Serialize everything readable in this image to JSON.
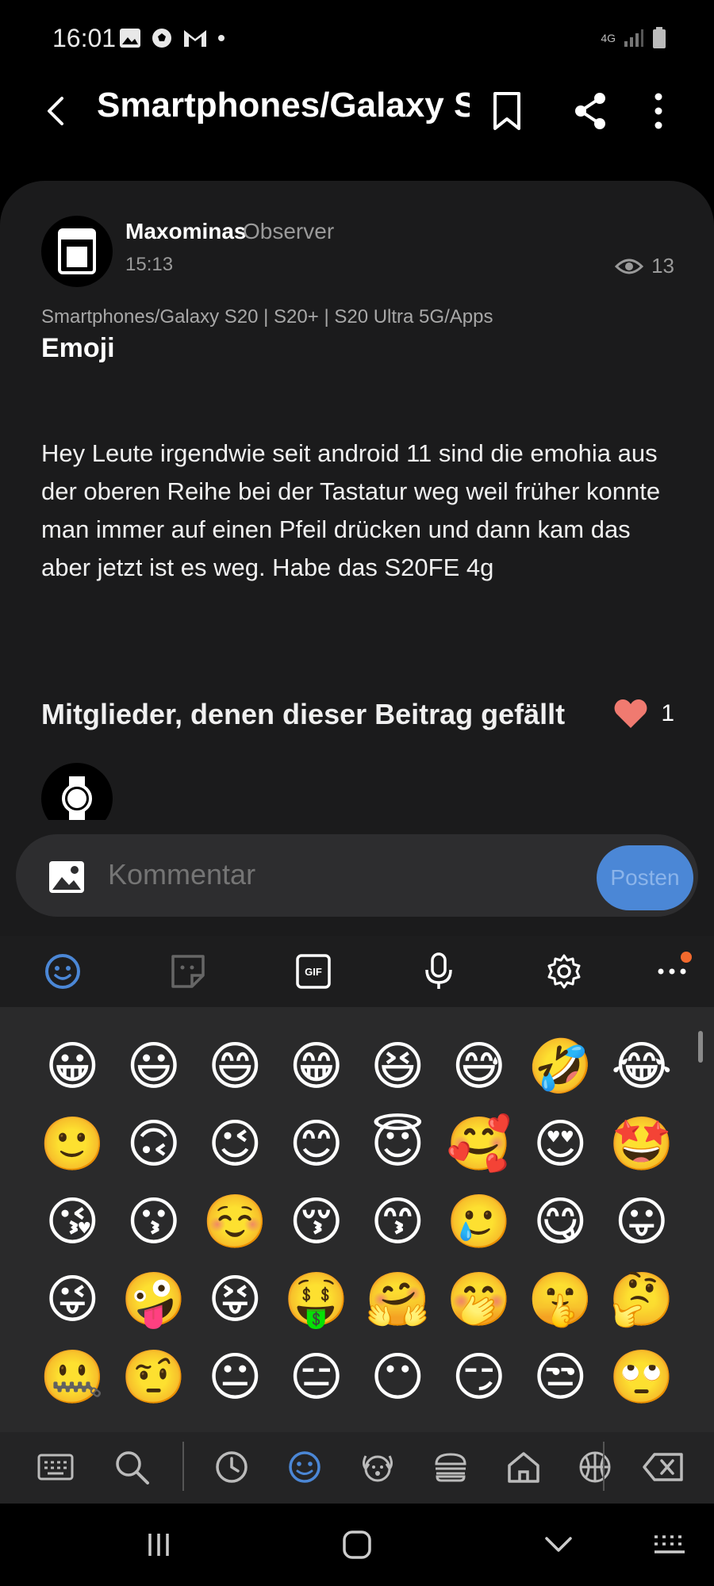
{
  "status_bar": {
    "time": "16:01",
    "network": "4G"
  },
  "header": {
    "title": "Smartphones/Galaxy S..."
  },
  "post": {
    "author": "Maxominas",
    "rank": "Observer",
    "time": "15:13",
    "views": "13",
    "category": "Smartphones/Galaxy S20 | S20+ | S20 Ultra 5G/Apps",
    "title": "Emoji",
    "body": "Hey Leute irgendwie seit android 11 sind die emohia aus der oberen Reihe bei der Tastatur weg weil früher konnte man immer auf einen Pfeil drücken und dann kam das aber jetzt ist es weg. Habe das S20FE 4g",
    "likes_heading": "Mitglieder, denen dieser Beitrag gefällt",
    "likes_count": "1"
  },
  "comment": {
    "placeholder": "Kommentar",
    "post_label": "Posten"
  },
  "keyboard": {
    "gif_label": "GIF",
    "emojis": [
      "😀",
      "😃",
      "😄",
      "😁",
      "😆",
      "😅",
      "🤣",
      "😂",
      "🙂",
      "🙃",
      "😉",
      "😊",
      "😇",
      "🥰",
      "😍",
      "🤩",
      "😘",
      "😗",
      "☺️",
      "😚",
      "😙",
      "🥲",
      "😋",
      "😛",
      "😜",
      "🤪",
      "😝",
      "🤑",
      "🤗",
      "🤭",
      "🤫",
      "🤔",
      "🤐",
      "🤨",
      "😐",
      "😑",
      "😶",
      "😏",
      "😒",
      "🙄"
    ]
  },
  "colors": {
    "accent": "#4b87d6",
    "heart": "#f07a70",
    "badge": "#f26a2e"
  }
}
